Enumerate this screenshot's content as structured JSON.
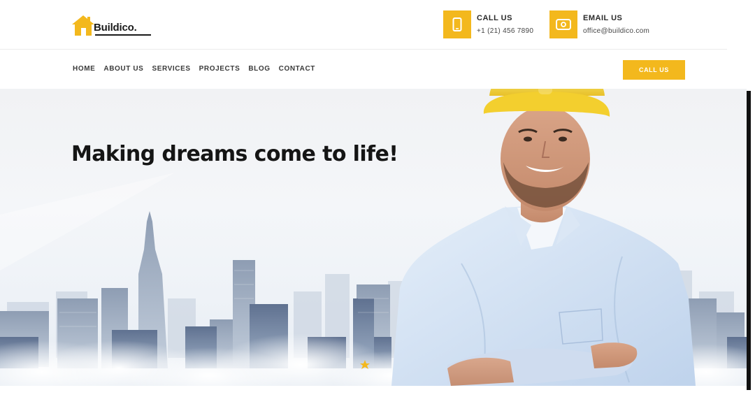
{
  "brand": {
    "name": "Buildico.",
    "accent": "#f3b81d"
  },
  "header": {
    "call": {
      "label": "CALL US",
      "value": "+1 (21) 456 7890",
      "icon": "phone-icon"
    },
    "email": {
      "label": "EMAIL US",
      "value": "office@buildico.com",
      "icon": "email-icon"
    }
  },
  "nav": {
    "items": [
      {
        "label": "HOME"
      },
      {
        "label": "ABOUT US"
      },
      {
        "label": "SERVICES"
      },
      {
        "label": "PROJECTS"
      },
      {
        "label": "BLOG"
      },
      {
        "label": "CONTACT"
      }
    ],
    "cta_label": "CALL US"
  },
  "hero": {
    "title": "Making dreams come to life!"
  }
}
